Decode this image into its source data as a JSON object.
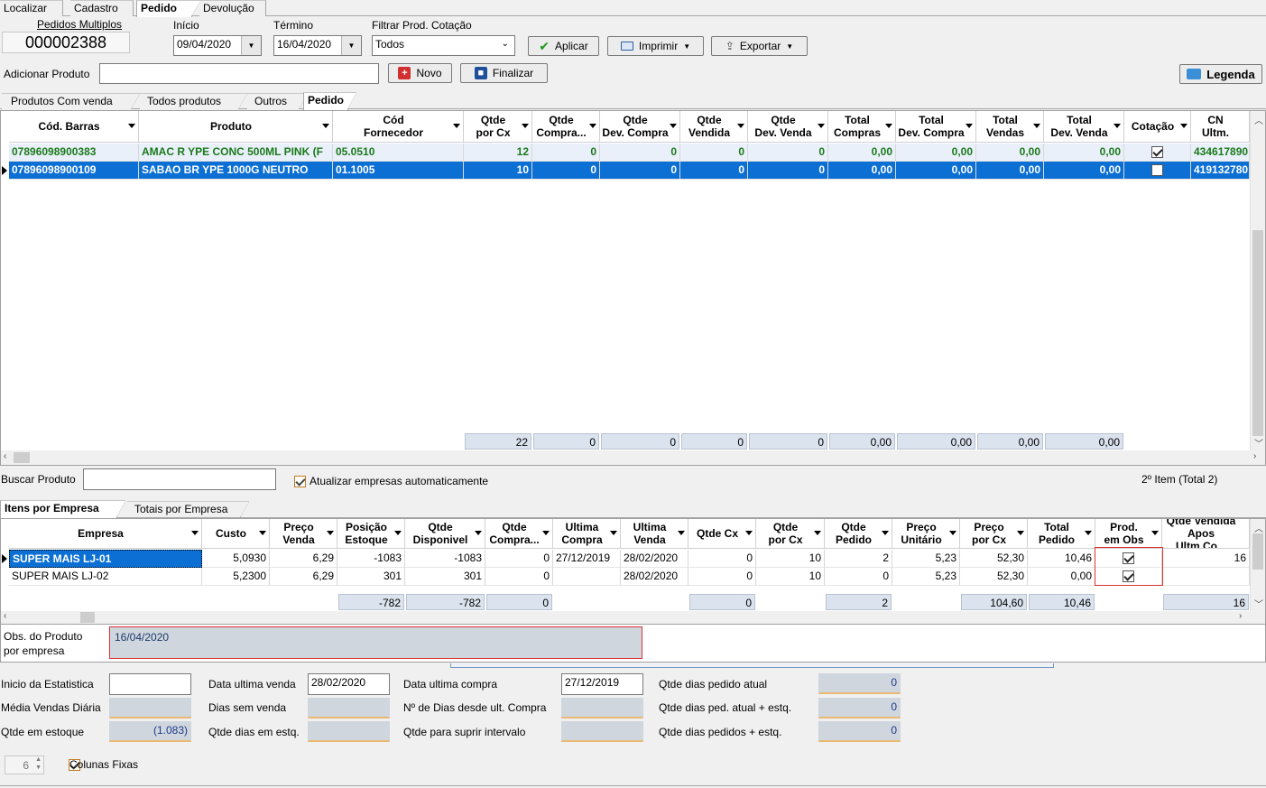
{
  "top_tabs": [
    "Localizar",
    "Cadastro",
    "Pedido",
    "Devolução"
  ],
  "header": {
    "pedidos_label": "Pedidos Multiplos",
    "pedido_number": "000002388",
    "inicio_label": "Início",
    "inicio_value": "09/04/2020",
    "termino_label": "Término",
    "termino_value": "16/04/2020",
    "filtrar_label": "Filtrar Prod. Cotação",
    "filtrar_value": "Todos",
    "aplicar": "Aplicar",
    "imprimir": "Imprimir",
    "exportar": "Exportar",
    "adicionar_label": "Adicionar Produto",
    "novo": "Novo",
    "finalizar": "Finalizar",
    "legenda": "Legenda"
  },
  "product_tabs": [
    "Produtos Com venda",
    "Todos produtos",
    "Outros",
    "Pedido"
  ],
  "products": {
    "columns": [
      [
        "Cód. Barras",
        ""
      ],
      [
        "Produto",
        ""
      ],
      [
        "Cód",
        "Fornecedor"
      ],
      [
        "Qtde",
        "por Cx"
      ],
      [
        "Qtde",
        "Compra..."
      ],
      [
        "Qtde",
        "Dev. Compra"
      ],
      [
        "Qtde",
        "Vendida"
      ],
      [
        "Qtde",
        "Dev. Venda"
      ],
      [
        "Total",
        "Compras"
      ],
      [
        "Total",
        "Dev. Compra"
      ],
      [
        "Total",
        "Vendas"
      ],
      [
        "Total",
        "Dev. Venda"
      ],
      [
        "Cotação",
        ""
      ],
      [
        "CN",
        "Ultm."
      ]
    ],
    "rows": [
      {
        "barcode": "07896098900383",
        "produto": "AMAC R YPE CONC 500ML PINK (F",
        "fornecedor": "05.0510",
        "por_cx": "12",
        "compra": "0",
        "dev_compra": "0",
        "vendida": "0",
        "dev_venda": "0",
        "t_compras": "0,00",
        "t_dev_compra": "0,00",
        "t_vendas": "0,00",
        "t_dev_venda": "0,00",
        "cotacao": true,
        "cn": "434617890"
      },
      {
        "barcode": "07896098900109",
        "produto": "SABAO BR YPE 1000G NEUTRO",
        "fornecedor": "01.1005",
        "por_cx": "10",
        "compra": "0",
        "dev_compra": "0",
        "vendida": "0",
        "dev_venda": "0",
        "t_compras": "0,00",
        "t_dev_compra": "0,00",
        "t_vendas": "0,00",
        "t_dev_venda": "0,00",
        "cotacao": false,
        "cn": "419132780"
      }
    ],
    "totals": [
      "22",
      "0",
      "0",
      "0",
      "0",
      "0,00",
      "0,00",
      "0,00",
      "0,00"
    ]
  },
  "buscar": {
    "label": "Buscar Produto",
    "atualizar_label": "Atualizar empresas automaticamente",
    "item_info": "2º Item (Total 2)"
  },
  "empresa_tabs": [
    "Itens por Empresa",
    "Totais por Empresa"
  ],
  "empresas": {
    "columns": [
      [
        "Empresa",
        ""
      ],
      [
        "Custo",
        ""
      ],
      [
        "Preço",
        "Venda"
      ],
      [
        "Posição",
        "Estoque"
      ],
      [
        "Qtde",
        "Disponivel"
      ],
      [
        "Qtde",
        "Compra..."
      ],
      [
        "Ultima",
        "Compra"
      ],
      [
        "Ultima",
        "Venda"
      ],
      [
        "Qtde Cx",
        ""
      ],
      [
        "Qtde",
        "por Cx"
      ],
      [
        "Qtde",
        "Pedido"
      ],
      [
        "Preço",
        "Unitário"
      ],
      [
        "Preço",
        "por Cx"
      ],
      [
        "Total",
        "Pedido"
      ],
      [
        "Prod.",
        "em Obs"
      ],
      [
        "Qtde Vendida",
        "Apos Ultm.Co..."
      ]
    ],
    "rows": [
      {
        "empresa": "SUPER MAIS LJ-01",
        "custo": "5,0930",
        "preco": "6,29",
        "estoque": "-1083",
        "disponivel": "-1083",
        "compra": "0",
        "ult_compra": "27/12/2019",
        "ult_venda": "28/02/2020",
        "qtde_cx": "0",
        "por_cx": "10",
        "pedido": "2",
        "unitario": "5,23",
        "preco_cx": "52,30",
        "total": "10,46",
        "obs": true,
        "apos": "16"
      },
      {
        "empresa": "SUPER MAIS LJ-02",
        "custo": "5,2300",
        "preco": "6,29",
        "estoque": "301",
        "disponivel": "301",
        "compra": "0",
        "ult_compra": "",
        "ult_venda": "28/02/2020",
        "qtde_cx": "0",
        "por_cx": "10",
        "pedido": "0",
        "unitario": "5,23",
        "preco_cx": "52,30",
        "total": "0,00",
        "obs": true,
        "apos": ""
      }
    ],
    "totals": {
      "estoque": "-782",
      "disponivel": "-782",
      "compra": "0",
      "qtde_cx": "0",
      "pedido": "2",
      "preco_cx": "104,60",
      "total": "10,46",
      "apos": "16"
    }
  },
  "obs": {
    "label_1": "Obs. do Produto",
    "label_2": "por empresa",
    "value": "16/04/2020"
  },
  "stats": {
    "inicio_label": "Inicio da Estatistica",
    "media_label": "Média Vendas Diária",
    "estoque_label": "Qtde em estoque",
    "estoque_value": "(1.083)",
    "data_venda_label": "Data ultima venda",
    "data_venda_value": "28/02/2020",
    "dias_sem_label": "Dias sem venda",
    "dias_estq_label": "Qtde dias em estq.",
    "data_compra_label": "Data ultima compra",
    "data_compra_value": "27/12/2019",
    "dias_desde_label": "Nº de Dias desde ult. Compra",
    "suprir_label": "Qtde para suprir intervalo",
    "dias_atual_label": "Qtde dias pedido atual",
    "dias_atual_value": "0",
    "dias_ped_estq_label": "Qtde dias ped. atual + estq.",
    "dias_ped_estq_value": "0",
    "dias_pedidos_label": "Qtde dias pedidos + estq.",
    "dias_pedidos_value": "0"
  },
  "footer": {
    "spinner_value": "6",
    "colunas_label": "Colunas Fixas"
  }
}
